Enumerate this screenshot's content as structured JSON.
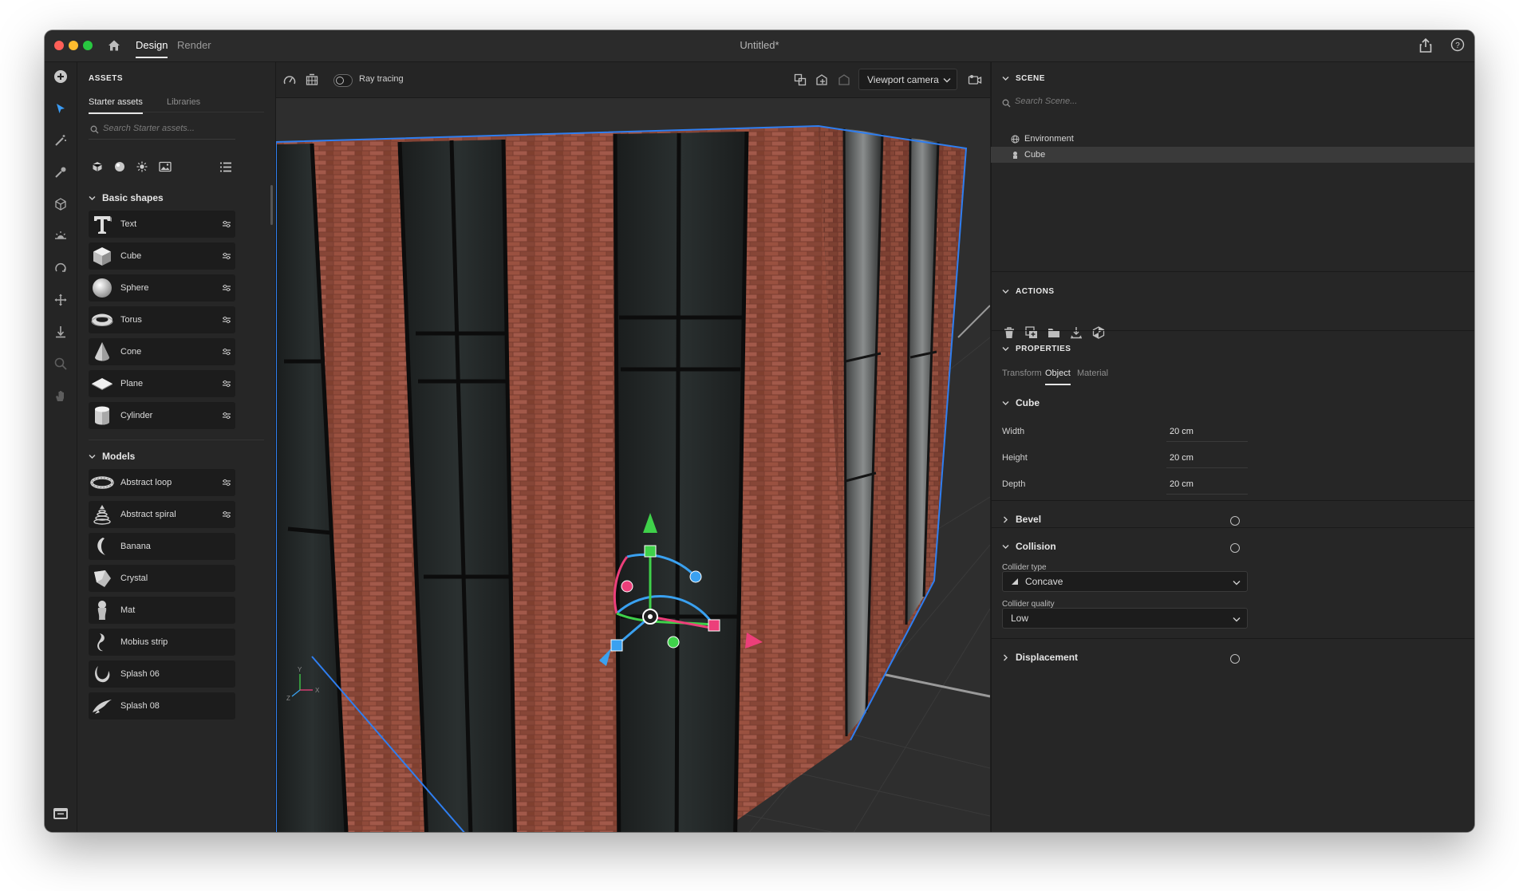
{
  "window": {
    "title": "Untitled*",
    "tabs": [
      {
        "label": "Design",
        "active": true
      },
      {
        "label": "Render",
        "active": false
      }
    ],
    "icons": [
      "home-icon",
      "share-icon",
      "help-icon"
    ]
  },
  "toolstrip": {
    "tools": [
      "add-icon",
      "select-icon",
      "magic-wand-icon",
      "eyedropper-icon",
      "cube-outline-icon",
      "horizon-icon",
      "orbit-icon",
      "move-icon",
      "drop-to-ground-icon",
      "zoom-icon",
      "hand-icon",
      "panel-toggle-icon"
    ]
  },
  "assets": {
    "title": "ASSETS",
    "tabs": [
      {
        "label": "Starter assets",
        "active": true
      },
      {
        "label": "Libraries",
        "active": false
      }
    ],
    "search_placeholder": "Search Starter assets...",
    "filter_icons": [
      "model-filter-icon",
      "material-filter-icon",
      "light-filter-icon",
      "image-filter-icon",
      "list-view-icon"
    ],
    "basic_shapes": {
      "title": "Basic shapes",
      "items": [
        "Text",
        "Cube",
        "Sphere",
        "Torus",
        "Cone",
        "Plane",
        "Cylinder"
      ]
    },
    "models": {
      "title": "Models",
      "items": [
        "Abstract loop",
        "Abstract spiral",
        "Banana",
        "Crystal",
        "Mat",
        "Mobius strip",
        "Splash 06",
        "Splash 08"
      ]
    }
  },
  "viewport": {
    "ray_tracing_label": "Ray tracing",
    "ray_tracing_on": false,
    "camera_select": "Viewport camera",
    "axis_labels": {
      "y": "Y",
      "x": "X",
      "z": "Z"
    }
  },
  "scene": {
    "title": "SCENE",
    "search_placeholder": "Search Scene...",
    "items": [
      {
        "label": "Environment",
        "selected": false
      },
      {
        "label": "Cube",
        "selected": true
      }
    ]
  },
  "actions": {
    "title": "ACTIONS",
    "icons": [
      "delete-icon",
      "duplicate-icon",
      "group-icon",
      "drop-icon",
      "convert-icon"
    ]
  },
  "properties": {
    "title": "PROPERTIES",
    "tabs": [
      {
        "label": "Transform",
        "active": false
      },
      {
        "label": "Object",
        "active": true
      },
      {
        "label": "Material",
        "active": false
      }
    ],
    "object_section": "Cube",
    "fields": [
      {
        "label": "Width",
        "value": "20 cm"
      },
      {
        "label": "Height",
        "value": "20 cm"
      },
      {
        "label": "Depth",
        "value": "20 cm"
      }
    ],
    "bevel": {
      "label": "Bevel",
      "enabled": false
    },
    "collision": {
      "label": "Collision",
      "enabled": false,
      "collider_type_label": "Collider type",
      "collider_type": "Concave",
      "collider_quality_label": "Collider quality",
      "collider_quality": "Low"
    },
    "displacement": {
      "label": "Displacement",
      "enabled": false
    }
  },
  "colors": {
    "accent_blue": "#3b82f6",
    "gizmo_green": "#3fd14a",
    "gizmo_red": "#ec3f7a",
    "gizmo_blue": "#3aa1f0",
    "brick": "#8a4536"
  }
}
